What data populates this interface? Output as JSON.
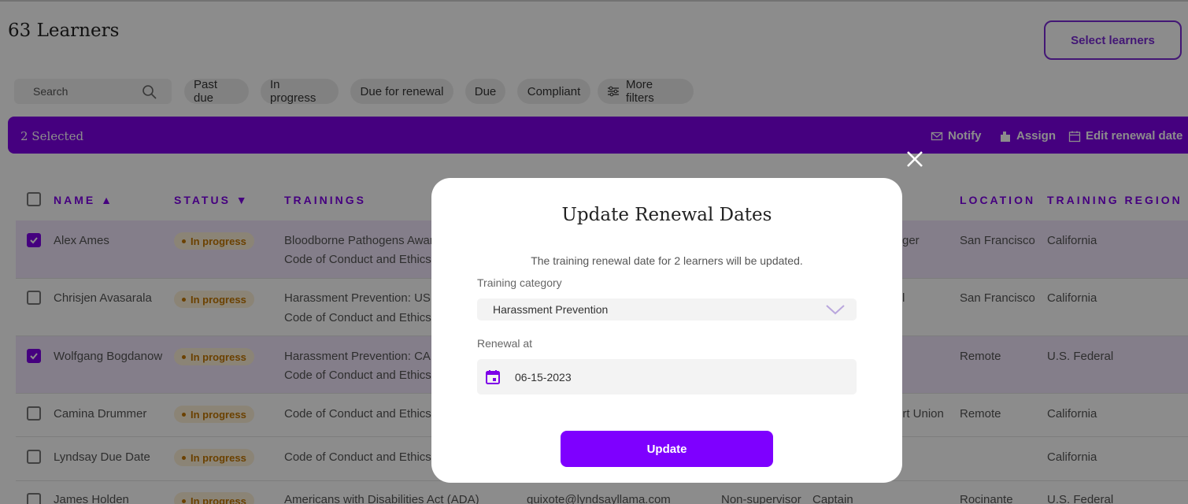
{
  "page": {
    "title": "63 Learners",
    "select_learners": "Select learners"
  },
  "filters": {
    "search_placeholder": "Search",
    "chips": [
      "Past due",
      "In progress",
      "Due for renewal",
      "Due",
      "Compliant"
    ],
    "more_filters": "More filters"
  },
  "selection_bar": {
    "count": "2 Selected",
    "notify": "Notify",
    "assign": "Assign",
    "edit_renewal": "Edit renewal date"
  },
  "table": {
    "headers": {
      "name": "NAME ▲",
      "status": "STATUS ▼",
      "trainings": "TRAININGS",
      "location": "LOCATION",
      "region": "TRAINING REGION"
    },
    "rows": [
      {
        "name": "Alex Ames",
        "status": "In progress",
        "t1": "Bloodborne Pathogens Awar",
        "t2": "Code of Conduct and Ethics",
        "extra": "ger",
        "location": "San Francisco",
        "region": "California",
        "checked": true
      },
      {
        "name": "Chrisjen Avasarala",
        "status": "In progress",
        "t1": "Harassment Prevention: US N",
        "t2": "Code of Conduct and Ethics",
        "extra": "l",
        "location": "San Francisco",
        "region": "California",
        "checked": false
      },
      {
        "name": "Wolfgang Bogdanow",
        "status": "In progress",
        "t1": "Harassment Prevention: CA S",
        "t2": "Code of Conduct and Ethics",
        "extra": "",
        "location": "Remote",
        "region": "U.S. Federal",
        "checked": true
      },
      {
        "name": "Camina Drummer",
        "status": "In progress",
        "t1": "Code of Conduct and Ethics",
        "t2": "",
        "extra": "ort Union",
        "location": "Remote",
        "region": "California",
        "checked": false
      },
      {
        "name": "Lyndsay Due Date",
        "status": "In progress",
        "t1": "Code of Conduct and Ethics",
        "t2": "",
        "extra": "",
        "location": "",
        "region": "California",
        "checked": false
      },
      {
        "name": "James Holden",
        "status": "In progress",
        "t1": "Americans with Disabilities Act (ADA)",
        "t2": "",
        "email": "quixote@lyndsayllama.com",
        "role": "Non-supervisor",
        "job": "Captain",
        "location": "Rocinante",
        "region": "U.S. Federal",
        "checked": false
      }
    ]
  },
  "modal": {
    "title": "Update Renewal Dates",
    "description": "The training renewal date for 2 learners will be updated.",
    "category_label": "Training category",
    "category_value": "Harassment Prevention",
    "renewal_label": "Renewal at",
    "renewal_value": "06-15-2023",
    "update_button": "Update"
  },
  "colors": {
    "accent": "#7e00e8",
    "badge_bg": "#fdf0d8",
    "badge_text": "#c47700"
  }
}
